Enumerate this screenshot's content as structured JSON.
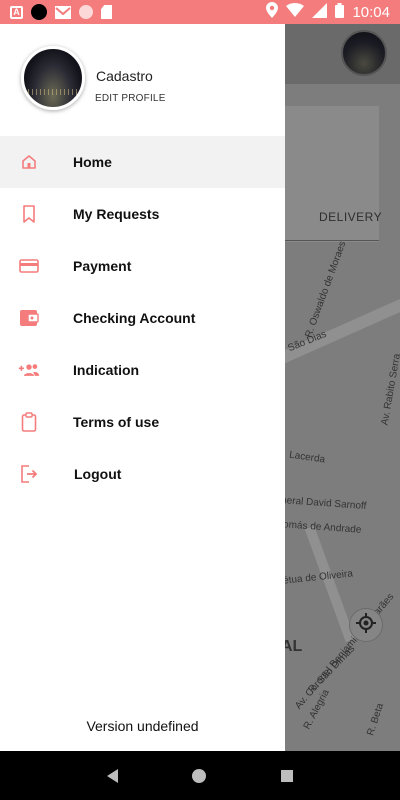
{
  "status_bar": {
    "time": "10:04",
    "background": "#f47c7c"
  },
  "profile": {
    "name": "Cadastro",
    "edit_label": "EDIT PROFILE"
  },
  "menu": {
    "accent": "#f47c7c",
    "items": [
      {
        "label": "Home",
        "icon": "home-icon",
        "active": true
      },
      {
        "label": "My Requests",
        "icon": "bookmark-icon",
        "active": false
      },
      {
        "label": "Payment",
        "icon": "credit-card-icon",
        "active": false
      },
      {
        "label": "Checking Account",
        "icon": "wallet-icon",
        "active": false
      },
      {
        "label": "Indication",
        "icon": "add-people-icon",
        "active": false
      },
      {
        "label": "Terms of use",
        "icon": "clipboard-icon",
        "active": false
      },
      {
        "label": "Logout",
        "icon": "logout-icon",
        "active": false
      }
    ]
  },
  "version": "Version undefined",
  "map": {
    "tab_label": "DELIVERY",
    "streets": [
      "R. Oswaldo de Moraes",
      "São Dias",
      "Lacerda",
      "neral David Sarnoff",
      "omás de Andrade",
      "étua de Oliveira",
      "Av. Coronel Benjamin Guimarães",
      "R. São Dimas",
      "R. Alegria",
      "R. Beta",
      "Av. Rabito Serra"
    ],
    "district": "AL"
  }
}
